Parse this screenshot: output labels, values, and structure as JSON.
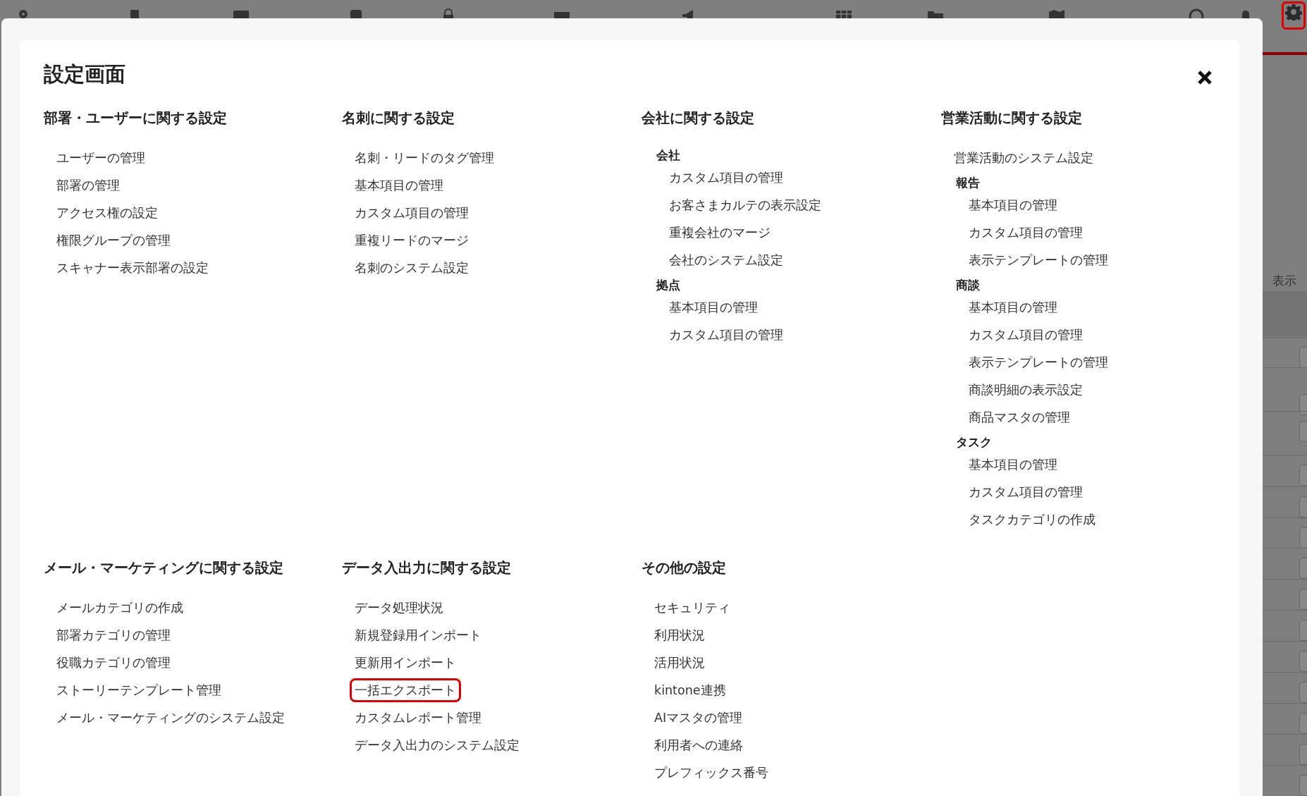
{
  "top_bar": {
    "settings_button": {
      "highlighted": true
    }
  },
  "background": {
    "page_text": "表示"
  },
  "dialog": {
    "title": "設定画面",
    "sections": [
      {
        "heading": "部署・ユーザーに関する設定",
        "items": [
          {
            "kind": "link",
            "label": "ユーザーの管理",
            "highlighted": false
          },
          {
            "kind": "link",
            "label": "部署の管理",
            "highlighted": false
          },
          {
            "kind": "link",
            "label": "アクセス権の設定",
            "highlighted": false
          },
          {
            "kind": "link",
            "label": "権限グループの管理",
            "highlighted": false
          },
          {
            "kind": "link",
            "label": "スキャナー表示部署の設定",
            "highlighted": false
          }
        ]
      },
      {
        "heading": "名刺に関する設定",
        "items": [
          {
            "kind": "link",
            "label": "名刺・リードのタグ管理",
            "highlighted": false
          },
          {
            "kind": "link",
            "label": "基本項目の管理",
            "highlighted": false
          },
          {
            "kind": "link",
            "label": "カスタム項目の管理",
            "highlighted": false
          },
          {
            "kind": "link",
            "label": "重複リードのマージ",
            "highlighted": false
          },
          {
            "kind": "link",
            "label": "名刺のシステム設定",
            "highlighted": false
          }
        ]
      },
      {
        "heading": "会社に関する設定",
        "items": [
          {
            "kind": "group",
            "label": "会社",
            "children": [
              {
                "kind": "link",
                "label": "カスタム項目の管理",
                "highlighted": false
              },
              {
                "kind": "link",
                "label": "お客さまカルテの表示設定",
                "highlighted": false
              },
              {
                "kind": "link",
                "label": "重複会社のマージ",
                "highlighted": false
              },
              {
                "kind": "link",
                "label": "会社のシステム設定",
                "highlighted": false
              }
            ]
          },
          {
            "kind": "group",
            "label": "拠点",
            "children": [
              {
                "kind": "link",
                "label": "基本項目の管理",
                "highlighted": false
              },
              {
                "kind": "link",
                "label": "カスタム項目の管理",
                "highlighted": false
              }
            ]
          }
        ]
      },
      {
        "heading": "営業活動に関する設定",
        "items": [
          {
            "kind": "link",
            "label": "営業活動のシステム設定",
            "highlighted": false
          },
          {
            "kind": "group",
            "label": "報告",
            "children": [
              {
                "kind": "link",
                "label": "基本項目の管理",
                "highlighted": false
              },
              {
                "kind": "link",
                "label": "カスタム項目の管理",
                "highlighted": false
              },
              {
                "kind": "link",
                "label": "表示テンプレートの管理",
                "highlighted": false
              }
            ]
          },
          {
            "kind": "group",
            "label": "商談",
            "children": [
              {
                "kind": "link",
                "label": "基本項目の管理",
                "highlighted": false
              },
              {
                "kind": "link",
                "label": "カスタム項目の管理",
                "highlighted": false
              },
              {
                "kind": "link",
                "label": "表示テンプレートの管理",
                "highlighted": false
              },
              {
                "kind": "link",
                "label": "商談明細の表示設定",
                "highlighted": false
              },
              {
                "kind": "link",
                "label": "商品マスタの管理",
                "highlighted": false
              }
            ]
          },
          {
            "kind": "group",
            "label": "タスク",
            "children": [
              {
                "kind": "link",
                "label": "基本項目の管理",
                "highlighted": false
              },
              {
                "kind": "link",
                "label": "カスタム項目の管理",
                "highlighted": false
              },
              {
                "kind": "link",
                "label": "タスクカテゴリの作成",
                "highlighted": false
              }
            ]
          }
        ]
      },
      {
        "heading": "メール・マーケティングに関する設定",
        "items": [
          {
            "kind": "link",
            "label": "メールカテゴリの作成",
            "highlighted": false
          },
          {
            "kind": "link",
            "label": "部署カテゴリの管理",
            "highlighted": false
          },
          {
            "kind": "link",
            "label": "役職カテゴリの管理",
            "highlighted": false
          },
          {
            "kind": "link",
            "label": "ストーリーテンプレート管理",
            "highlighted": false
          },
          {
            "kind": "link",
            "label": "メール・マーケティングのシステム設定",
            "highlighted": false
          }
        ]
      },
      {
        "heading": "データ入出力に関する設定",
        "items": [
          {
            "kind": "link",
            "label": "データ処理状況",
            "highlighted": false
          },
          {
            "kind": "link",
            "label": "新規登録用インポート",
            "highlighted": false
          },
          {
            "kind": "link",
            "label": "更新用インポート",
            "highlighted": false
          },
          {
            "kind": "link",
            "label": "一括エクスポート",
            "highlighted": true
          },
          {
            "kind": "link",
            "label": "カスタムレポート管理",
            "highlighted": false
          },
          {
            "kind": "link",
            "label": "データ入出力のシステム設定",
            "highlighted": false
          }
        ]
      },
      {
        "heading": "その他の設定",
        "items": [
          {
            "kind": "link",
            "label": "セキュリティ",
            "highlighted": false
          },
          {
            "kind": "link",
            "label": "利用状況",
            "highlighted": false
          },
          {
            "kind": "link",
            "label": "活用状況",
            "highlighted": false
          },
          {
            "kind": "link",
            "label": "kintone連携",
            "highlighted": false
          },
          {
            "kind": "link",
            "label": "AIマスタの管理",
            "highlighted": false
          },
          {
            "kind": "link",
            "label": "利用者への連絡",
            "highlighted": false
          },
          {
            "kind": "link",
            "label": "プレフィックス番号",
            "highlighted": false
          }
        ]
      }
    ]
  }
}
